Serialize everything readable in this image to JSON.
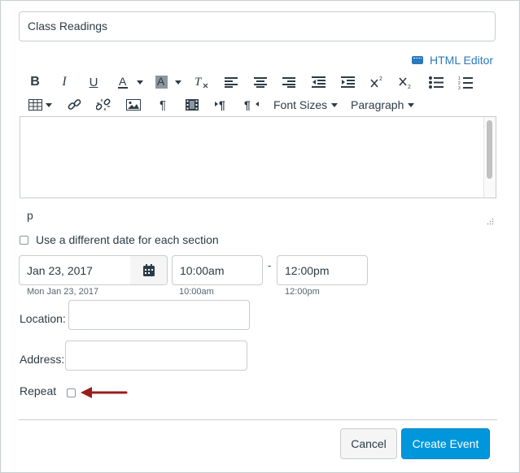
{
  "form": {
    "title_value": "Class Readings",
    "html_editor_label": "HTML Editor",
    "font_sizes_label": "Font Sizes",
    "paragraph_label": "Paragraph",
    "path_label": "p",
    "different_date_label": "Use a different date for each section",
    "date_value": "Jan 23, 2017",
    "date_hint": "Mon Jan 23, 2017",
    "start_time_value": "10:00am",
    "start_time_hint": "10:00am",
    "time_separator": "-",
    "end_time_value": "12:00pm",
    "end_time_hint": "12:00pm",
    "location_label": "Location:",
    "location_value": "",
    "address_label": "Address:",
    "address_value": "",
    "repeat_label": "Repeat",
    "repeat_checked": false,
    "different_date_checked": false
  },
  "buttons": {
    "cancel": "Cancel",
    "create": "Create Event"
  },
  "toolbar_icons": [
    "bold-icon",
    "italic-icon",
    "underline-icon",
    "text-color-icon",
    "background-color-icon",
    "clear-formatting-icon",
    "align-left-icon",
    "align-center-icon",
    "align-right-icon",
    "outdent-icon",
    "indent-icon",
    "superscript-icon",
    "subscript-icon",
    "bullet-list-icon",
    "numbered-list-icon",
    "table-icon",
    "link-icon",
    "unlink-icon",
    "image-icon",
    "pilcrow-icon",
    "media-icon",
    "ltr-icon",
    "rtl-icon"
  ],
  "colors": {
    "link": "#2b7abc",
    "primary_button": "#0096db",
    "arrow": "#9b1c1c",
    "border": "#c7cdd1"
  }
}
